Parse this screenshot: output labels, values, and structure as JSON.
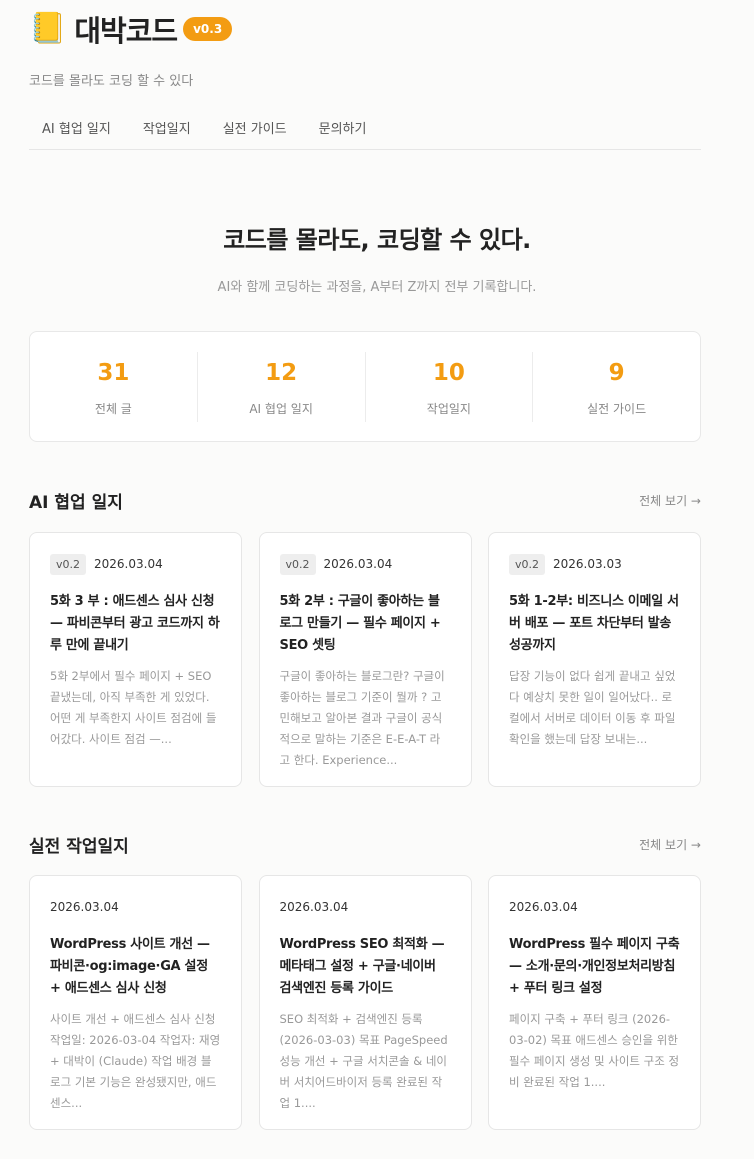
{
  "header": {
    "brand_icon": "📒",
    "brand_name": "대박코드",
    "version": "v0.3",
    "tagline": "코드를 몰라도 코딩 할 수 있다"
  },
  "nav": [
    {
      "label": "AI 협업 일지"
    },
    {
      "label": "작업일지"
    },
    {
      "label": "실전 가이드"
    },
    {
      "label": "문의하기"
    }
  ],
  "hero": {
    "title": "코드를 몰라도, 코딩할 수 있다.",
    "subtitle": "AI와 함께 코딩하는 과정을, A부터 Z까지 전부 기록합니다."
  },
  "stats": [
    {
      "value": "31",
      "label": "전체 글"
    },
    {
      "value": "12",
      "label": "AI 협업 일지"
    },
    {
      "value": "10",
      "label": "작업일지"
    },
    {
      "value": "9",
      "label": "실전 가이드"
    }
  ],
  "colors": {
    "accent": "#f39c12"
  },
  "sections": [
    {
      "title": "AI 협업 일지",
      "see_all": "전체 보기 →",
      "cards": [
        {
          "version": "v0.2",
          "date": "2026.03.04",
          "title": "5화 3 부 : 애드센스 심사 신청 — 파비콘부터 광고 코드까지 하루 만에 끝내기",
          "excerpt": "5화 2부에서 필수 페이지 + SEO 끝냈는데, 아직 부족한 게 있었다. 어떤 게 부족한지 사이트 점검에 들어갔다. 사이트 점검 —..."
        },
        {
          "version": "v0.2",
          "date": "2026.03.04",
          "title": "5화 2부 : 구글이 좋아하는 블로그 만들기 — 필수 페이지 + SEO 셋팅",
          "excerpt": "구글이 좋아하는 블로그란? 구글이 좋아하는 블로그 기준이 뭘까 ? 고민해보고 알아본 결과 구글이 공식적으로 말하는 기준은 E-E-A-T 라고 한다. Experience..."
        },
        {
          "version": "v0.2",
          "date": "2026.03.03",
          "title": "5화 1-2부: 비즈니스 이메일 서버 배포 — 포트 차단부터 발송 성공까지",
          "excerpt": "답장 기능이 없다 쉽게 끝내고 싶었다 예상치 못한 일이 일어났다.. 로컬에서 서버로 데이터 이동 후 파일 확인을 했는데 답장 보내는..."
        }
      ]
    },
    {
      "title": "실전 작업일지",
      "see_all": "전체 보기 →",
      "cards": [
        {
          "date": "2026.03.04",
          "title": "WordPress 사이트 개선 — 파비콘·og:image·GA 설정 + 애드센스 심사 신청",
          "excerpt": "사이트 개선 + 애드센스 심사 신청 작업일: 2026-03-04 작업자: 재영 + 대박이 (Claude) 작업 배경 블로그 기본 기능은 완성됐지만, 애드센스..."
        },
        {
          "date": "2026.03.04",
          "title": "WordPress SEO 최적화 — 메타태그 설정 + 구글·네이버 검색엔진 등록 가이드",
          "excerpt": "SEO 최적화 + 검색엔진 등록 (2026-03-03) 목표 PageSpeed 성능 개선 + 구글 서치콘솔 & 네이버 서치어드바이저 등록 완료된 작업 1...."
        },
        {
          "date": "2026.03.04",
          "title": "WordPress 필수 페이지 구축 — 소개·문의·개인정보처리방침 + 푸터 링크 설정",
          "excerpt": "페이지 구축 + 푸터 링크 (2026-03-02) 목표 애드센스 승인을 위한 필수 페이지 생성 및 사이트 구조 정비 완료된 작업 1...."
        }
      ]
    }
  ]
}
